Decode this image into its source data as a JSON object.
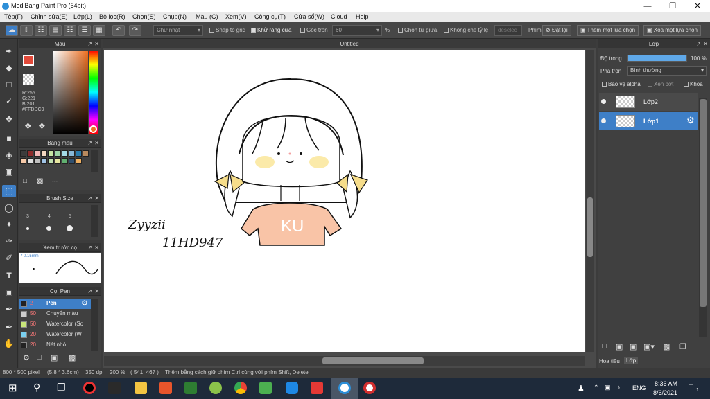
{
  "window": {
    "title": "MediBang Paint Pro (64bit)"
  },
  "menu": [
    "Tệp(F)",
    "Chỉnh sửa(E)",
    "Lớp(L)",
    "Bộ lọc(R)",
    "Chọn(S)",
    "Chụp(N)",
    "Màu (C)",
    "Xem(V)",
    "Công cụ(T)",
    "Cửa sổ(W)",
    "Cloud",
    "Help"
  ],
  "toolbar": {
    "shape_select": "Chữ nhật",
    "snap_to_grid": "Snap to grid",
    "antialias": "Khử răng cưa",
    "round_corner": "Góc tròn",
    "round_value": "60",
    "percent": "%",
    "select_from_center": "Chọn từ giữa",
    "no_ratio": "Không chế tỷ lệ",
    "deselect_placeholder": "deselec",
    "keys_label": "Phím",
    "reset": "Đặt lại",
    "add_selection": "Thêm một lựa chọn",
    "remove_selection": "Xóa một lựa chọn"
  },
  "color_panel": {
    "title": "Màu",
    "r": "R:255",
    "g": "G:221",
    "b": "B:201",
    "hex": "#FFDDC9",
    "fg_color": "#FFDDC9"
  },
  "palette_panel": {
    "title": "Bảng màu",
    "dash": "---",
    "swatches": [
      "#3b3b3b",
      "#8c2a2a",
      "#f4b6b6",
      "#f3d7c0",
      "#c8e6a3",
      "#9fd7a6",
      "#a3d9e6",
      "#88b8d8",
      "#2a7cae",
      "#b98a5e",
      "#f6c9a8",
      "#e0e0e0",
      "#c0c0c0",
      "#a0c4e6",
      "#c0e0b0",
      "#e6e6a0",
      "#60b070",
      "#305070",
      "#f0b060"
    ]
  },
  "brush_size_panel": {
    "title": "Brush Size",
    "sizes": [
      "3",
      "4",
      "5"
    ]
  },
  "preview_panel": {
    "title": "Xem trước cọ",
    "size_label": "* 0.15mm"
  },
  "brush_panel": {
    "title": "Cọ: Pen",
    "items": [
      {
        "size": "2",
        "name": "Pen",
        "color": "#222222"
      },
      {
        "size": "50",
        "name": "Chuyển màu",
        "color": "#cccccc"
      },
      {
        "size": "50",
        "name": "Watercolor (So",
        "color": "#c8e67a"
      },
      {
        "size": "20",
        "name": "Watercolor (W",
        "color": "#7ad0f0"
      },
      {
        "size": "20",
        "name": "Nét nhỏ",
        "color": "#222222"
      }
    ]
  },
  "document": {
    "tab": "Untitled",
    "signature_line1": "Zyyzii",
    "signature_line2": "11HD947",
    "shirt_text": "KU"
  },
  "layer_panel": {
    "title": "Lớp",
    "opacity_label": "Độ trong",
    "opacity_value": "100 %",
    "opacity_fraction": 1.0,
    "blend_label": "Pha trộn",
    "blend_value": "Bình thường",
    "protect_alpha": "Bảo vệ alpha",
    "clipping": "Xén bớt",
    "lock": "Khóa",
    "layers": [
      {
        "name": "Lớp2",
        "selected": false
      },
      {
        "name": "Lớp1",
        "selected": true
      }
    ],
    "bottom_tabs": [
      "Hoa tiêu",
      "Lớp"
    ]
  },
  "status": {
    "size": "800 * 500 pixel",
    "physical": "(5.8 * 3.6cm)",
    "dpi": "350 dpi",
    "zoom": "200 %",
    "coords": "( 541, 467 )",
    "hint": "Thêm bằng cách giữ phím Ctrl cùng với phím Shift, Delete"
  },
  "taskbar": {
    "lang": "ENG",
    "time": "8:36 AM",
    "date": "8/6/2021",
    "notif_count": "1"
  }
}
